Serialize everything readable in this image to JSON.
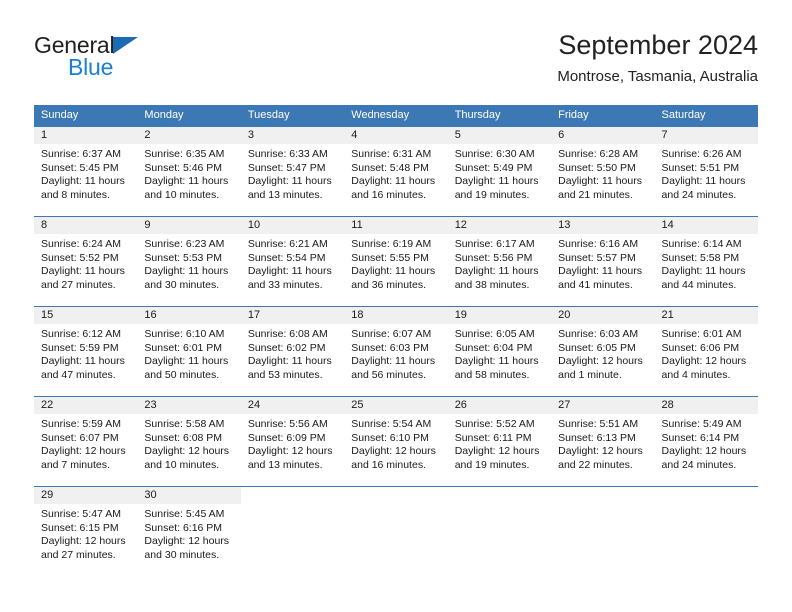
{
  "brand": {
    "line1": "General",
    "line2": "Blue",
    "triangle_color": "#1b6bb5",
    "blue_color": "#1b7fd4"
  },
  "header": {
    "title": "September 2024",
    "subtitle": "Montrose, Tasmania, Australia"
  },
  "theme": {
    "header_blue": "#3b78b4",
    "day_strip_gray": "#f0f0f0",
    "text_color": "#1a1a1a"
  },
  "weekdays": [
    "Sunday",
    "Monday",
    "Tuesday",
    "Wednesday",
    "Thursday",
    "Friday",
    "Saturday"
  ],
  "weeks": [
    [
      {
        "day": "1",
        "sunrise": "Sunrise: 6:37 AM",
        "sunset": "Sunset: 5:45 PM",
        "daylight1": "Daylight: 11 hours",
        "daylight2": "and 8 minutes."
      },
      {
        "day": "2",
        "sunrise": "Sunrise: 6:35 AM",
        "sunset": "Sunset: 5:46 PM",
        "daylight1": "Daylight: 11 hours",
        "daylight2": "and 10 minutes."
      },
      {
        "day": "3",
        "sunrise": "Sunrise: 6:33 AM",
        "sunset": "Sunset: 5:47 PM",
        "daylight1": "Daylight: 11 hours",
        "daylight2": "and 13 minutes."
      },
      {
        "day": "4",
        "sunrise": "Sunrise: 6:31 AM",
        "sunset": "Sunset: 5:48 PM",
        "daylight1": "Daylight: 11 hours",
        "daylight2": "and 16 minutes."
      },
      {
        "day": "5",
        "sunrise": "Sunrise: 6:30 AM",
        "sunset": "Sunset: 5:49 PM",
        "daylight1": "Daylight: 11 hours",
        "daylight2": "and 19 minutes."
      },
      {
        "day": "6",
        "sunrise": "Sunrise: 6:28 AM",
        "sunset": "Sunset: 5:50 PM",
        "daylight1": "Daylight: 11 hours",
        "daylight2": "and 21 minutes."
      },
      {
        "day": "7",
        "sunrise": "Sunrise: 6:26 AM",
        "sunset": "Sunset: 5:51 PM",
        "daylight1": "Daylight: 11 hours",
        "daylight2": "and 24 minutes."
      }
    ],
    [
      {
        "day": "8",
        "sunrise": "Sunrise: 6:24 AM",
        "sunset": "Sunset: 5:52 PM",
        "daylight1": "Daylight: 11 hours",
        "daylight2": "and 27 minutes."
      },
      {
        "day": "9",
        "sunrise": "Sunrise: 6:23 AM",
        "sunset": "Sunset: 5:53 PM",
        "daylight1": "Daylight: 11 hours",
        "daylight2": "and 30 minutes."
      },
      {
        "day": "10",
        "sunrise": "Sunrise: 6:21 AM",
        "sunset": "Sunset: 5:54 PM",
        "daylight1": "Daylight: 11 hours",
        "daylight2": "and 33 minutes."
      },
      {
        "day": "11",
        "sunrise": "Sunrise: 6:19 AM",
        "sunset": "Sunset: 5:55 PM",
        "daylight1": "Daylight: 11 hours",
        "daylight2": "and 36 minutes."
      },
      {
        "day": "12",
        "sunrise": "Sunrise: 6:17 AM",
        "sunset": "Sunset: 5:56 PM",
        "daylight1": "Daylight: 11 hours",
        "daylight2": "and 38 minutes."
      },
      {
        "day": "13",
        "sunrise": "Sunrise: 6:16 AM",
        "sunset": "Sunset: 5:57 PM",
        "daylight1": "Daylight: 11 hours",
        "daylight2": "and 41 minutes."
      },
      {
        "day": "14",
        "sunrise": "Sunrise: 6:14 AM",
        "sunset": "Sunset: 5:58 PM",
        "daylight1": "Daylight: 11 hours",
        "daylight2": "and 44 minutes."
      }
    ],
    [
      {
        "day": "15",
        "sunrise": "Sunrise: 6:12 AM",
        "sunset": "Sunset: 5:59 PM",
        "daylight1": "Daylight: 11 hours",
        "daylight2": "and 47 minutes."
      },
      {
        "day": "16",
        "sunrise": "Sunrise: 6:10 AM",
        "sunset": "Sunset: 6:01 PM",
        "daylight1": "Daylight: 11 hours",
        "daylight2": "and 50 minutes."
      },
      {
        "day": "17",
        "sunrise": "Sunrise: 6:08 AM",
        "sunset": "Sunset: 6:02 PM",
        "daylight1": "Daylight: 11 hours",
        "daylight2": "and 53 minutes."
      },
      {
        "day": "18",
        "sunrise": "Sunrise: 6:07 AM",
        "sunset": "Sunset: 6:03 PM",
        "daylight1": "Daylight: 11 hours",
        "daylight2": "and 56 minutes."
      },
      {
        "day": "19",
        "sunrise": "Sunrise: 6:05 AM",
        "sunset": "Sunset: 6:04 PM",
        "daylight1": "Daylight: 11 hours",
        "daylight2": "and 58 minutes."
      },
      {
        "day": "20",
        "sunrise": "Sunrise: 6:03 AM",
        "sunset": "Sunset: 6:05 PM",
        "daylight1": "Daylight: 12 hours",
        "daylight2": "and 1 minute."
      },
      {
        "day": "21",
        "sunrise": "Sunrise: 6:01 AM",
        "sunset": "Sunset: 6:06 PM",
        "daylight1": "Daylight: 12 hours",
        "daylight2": "and 4 minutes."
      }
    ],
    [
      {
        "day": "22",
        "sunrise": "Sunrise: 5:59 AM",
        "sunset": "Sunset: 6:07 PM",
        "daylight1": "Daylight: 12 hours",
        "daylight2": "and 7 minutes."
      },
      {
        "day": "23",
        "sunrise": "Sunrise: 5:58 AM",
        "sunset": "Sunset: 6:08 PM",
        "daylight1": "Daylight: 12 hours",
        "daylight2": "and 10 minutes."
      },
      {
        "day": "24",
        "sunrise": "Sunrise: 5:56 AM",
        "sunset": "Sunset: 6:09 PM",
        "daylight1": "Daylight: 12 hours",
        "daylight2": "and 13 minutes."
      },
      {
        "day": "25",
        "sunrise": "Sunrise: 5:54 AM",
        "sunset": "Sunset: 6:10 PM",
        "daylight1": "Daylight: 12 hours",
        "daylight2": "and 16 minutes."
      },
      {
        "day": "26",
        "sunrise": "Sunrise: 5:52 AM",
        "sunset": "Sunset: 6:11 PM",
        "daylight1": "Daylight: 12 hours",
        "daylight2": "and 19 minutes."
      },
      {
        "day": "27",
        "sunrise": "Sunrise: 5:51 AM",
        "sunset": "Sunset: 6:13 PM",
        "daylight1": "Daylight: 12 hours",
        "daylight2": "and 22 minutes."
      },
      {
        "day": "28",
        "sunrise": "Sunrise: 5:49 AM",
        "sunset": "Sunset: 6:14 PM",
        "daylight1": "Daylight: 12 hours",
        "daylight2": "and 24 minutes."
      }
    ],
    [
      {
        "day": "29",
        "sunrise": "Sunrise: 5:47 AM",
        "sunset": "Sunset: 6:15 PM",
        "daylight1": "Daylight: 12 hours",
        "daylight2": "and 27 minutes."
      },
      {
        "day": "30",
        "sunrise": "Sunrise: 5:45 AM",
        "sunset": "Sunset: 6:16 PM",
        "daylight1": "Daylight: 12 hours",
        "daylight2": "and 30 minutes."
      },
      {
        "day": "",
        "sunrise": "",
        "sunset": "",
        "daylight1": "",
        "daylight2": ""
      },
      {
        "day": "",
        "sunrise": "",
        "sunset": "",
        "daylight1": "",
        "daylight2": ""
      },
      {
        "day": "",
        "sunrise": "",
        "sunset": "",
        "daylight1": "",
        "daylight2": ""
      },
      {
        "day": "",
        "sunrise": "",
        "sunset": "",
        "daylight1": "",
        "daylight2": ""
      },
      {
        "day": "",
        "sunrise": "",
        "sunset": "",
        "daylight1": "",
        "daylight2": ""
      }
    ]
  ]
}
